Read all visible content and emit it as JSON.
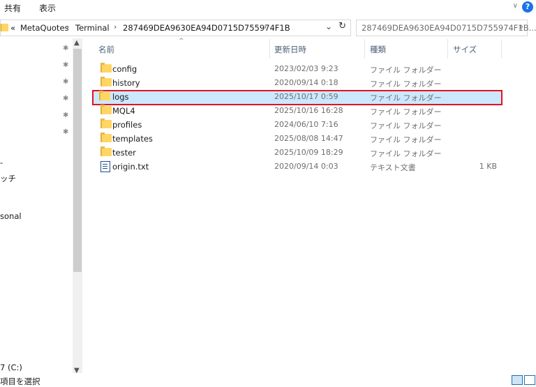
{
  "ribbon": {
    "share": "共有",
    "view": "表示"
  },
  "address": {
    "back": "«",
    "crumbs": [
      "MetaQuotes",
      "Terminal",
      "287469DEA9630EA94D0715D755974F1B"
    ],
    "sep": "›"
  },
  "search": {
    "placeholder": "287469DEA9630EA94D0715D755974F1B..."
  },
  "nav": {
    "items": [
      "-",
      "ッチ",
      "sonal",
      "7 (C:)"
    ]
  },
  "columns": {
    "name": "名前",
    "date": "更新日時",
    "type": "種類",
    "size": "サイズ"
  },
  "files": [
    {
      "name": "config",
      "date": "2023/02/03 9:23",
      "type": "ファイル フォルダー",
      "size": "",
      "kind": "folder"
    },
    {
      "name": "history",
      "date": "2020/09/14 0:18",
      "type": "ファイル フォルダー",
      "size": "",
      "kind": "folder"
    },
    {
      "name": "logs",
      "date": "2025/10/17 0:59",
      "type": "ファイル フォルダー",
      "size": "",
      "kind": "folder",
      "selected": true
    },
    {
      "name": "MQL4",
      "date": "2025/10/16 16:28",
      "type": "ファイル フォルダー",
      "size": "",
      "kind": "folder"
    },
    {
      "name": "profiles",
      "date": "2024/06/10 7:16",
      "type": "ファイル フォルダー",
      "size": "",
      "kind": "folder"
    },
    {
      "name": "templates",
      "date": "2025/08/08 14:47",
      "type": "ファイル フォルダー",
      "size": "",
      "kind": "folder"
    },
    {
      "name": "tester",
      "date": "2025/10/09 18:29",
      "type": "ファイル フォルダー",
      "size": "",
      "kind": "folder"
    },
    {
      "name": "origin.txt",
      "date": "2020/09/14 0:03",
      "type": "テキスト文書",
      "size": "1 KB",
      "kind": "text"
    }
  ],
  "status": {
    "text": "項目を選択"
  },
  "icons": {
    "help": "?"
  }
}
